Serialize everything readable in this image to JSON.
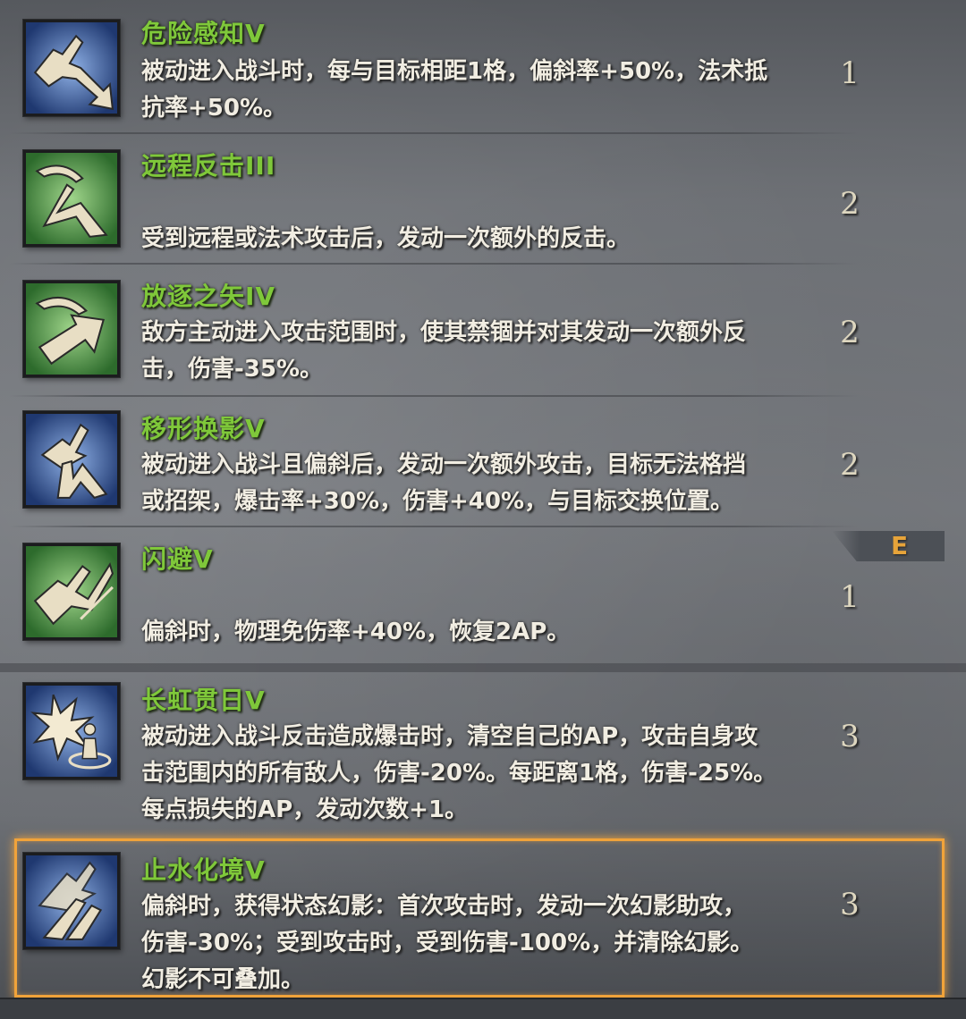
{
  "skills": [
    {
      "name": "危险感知V",
      "desc": [
        "被动进入战斗时，每与目标相距1格，偏斜率+50%，法术抵",
        "抗率+50%。"
      ],
      "cost": "1",
      "icon": "bird-arrow-deflect-icon",
      "icon_bg": "#2f4e8c"
    },
    {
      "name": "远程反击III",
      "desc": [
        "",
        "受到远程或法术攻击后，发动一次额外的反击。"
      ],
      "cost": "2",
      "icon": "bow-counter-icon",
      "icon_bg": "#3f8a3c"
    },
    {
      "name": "放逐之矢IV",
      "desc": [
        "敌方主动进入攻击范围时，使其禁锢并对其发动一次额外反",
        "击，伤害-35%。"
      ],
      "cost": "2",
      "icon": "bow-arrow-icon",
      "icon_bg": "#3f8a3c"
    },
    {
      "name": "移形换影V",
      "desc": [
        "被动进入战斗且偏斜后，发动一次额外攻击，目标无法格挡",
        "或招架，爆击率+30%，伤害+40%，与目标交换位置。"
      ],
      "cost": "2",
      "icon": "bird-swap-icon",
      "icon_bg": "#2f4e8c"
    },
    {
      "name": "闪避V",
      "desc": [
        "",
        "偏斜时，物理免伤率+40%，恢复2AP。"
      ],
      "cost": "1",
      "icon": "bird-dodge-icon",
      "icon_bg": "#3f8a3c"
    },
    {
      "name": "长虹贯日V",
      "desc": [
        "被动进入战斗反击造成爆击时，清空自己的AP，攻击自身攻",
        "击范围内的所有敌人，伤害-20%。每距离1格，伤害-25%。",
        "每点损失的AP，发动次数+1。"
      ],
      "cost": "3",
      "icon": "burst-figure-icon",
      "icon_bg": "#2f4e8c"
    },
    {
      "name": "止水化境V",
      "desc": [
        "偏斜时，获得状态幻影：首次攻击时，发动一次幻影助攻，",
        "伤害-30%；受到攻击时，受到伤害-100%，并清除幻影。",
        "幻影不可叠加。"
      ],
      "cost": "3",
      "icon": "phantom-bird-icon",
      "icon_bg": "#2f4e8c"
    }
  ],
  "equipped_tag": "E",
  "colors": {
    "name_green": "#7fc83a",
    "highlight_orange": "#f1a33a",
    "tag_orange": "#e7a43a"
  }
}
